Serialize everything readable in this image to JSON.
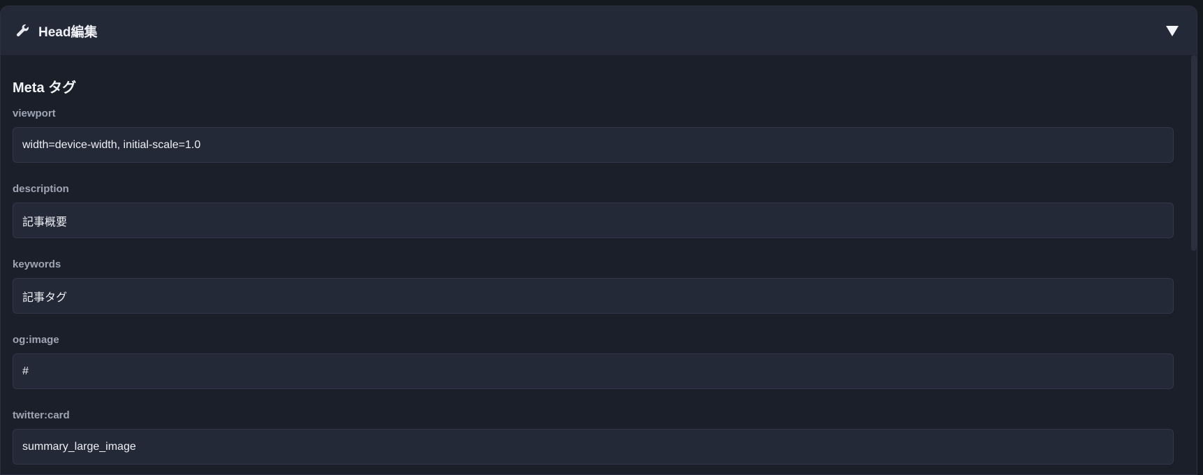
{
  "panel": {
    "title": "Head編集",
    "wrench_icon": "wrench-icon",
    "toggle_icon": "triangle-down-icon"
  },
  "section": {
    "title": "Meta タグ"
  },
  "fields": [
    {
      "label": "viewport",
      "value": "width=device-width, initial-scale=1.0"
    },
    {
      "label": "description",
      "value": "記事概要"
    },
    {
      "label": "keywords",
      "value": "記事タグ"
    },
    {
      "label": "og:image",
      "value": "#"
    },
    {
      "label": "twitter:card",
      "value": "summary_large_image"
    }
  ],
  "colors": {
    "background": "#1b1f29",
    "header": "#242938",
    "input": "#242938",
    "label": "#9ea6b6",
    "text": "#eef0f5"
  }
}
